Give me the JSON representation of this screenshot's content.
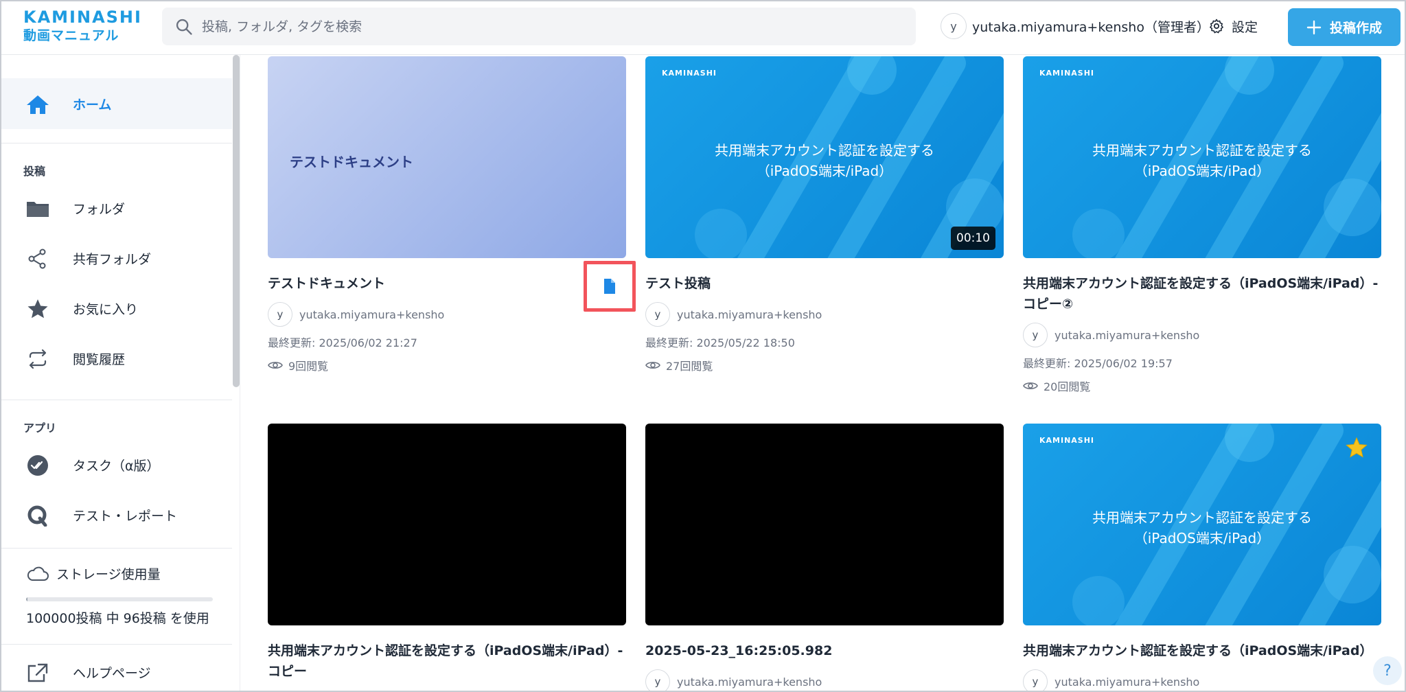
{
  "header": {
    "logo_main": "KAMINASHI",
    "logo_sub": "動画マニュアル",
    "search_placeholder": "投稿, フォルダ, タグを検索",
    "user_initial": "y",
    "user_name": "yutaka.miyamura+kensho（管理者）",
    "settings_label": "設定",
    "create_label": "投稿作成"
  },
  "sidebar": {
    "home": "ホーム",
    "section_posts": "投稿",
    "folder": "フォルダ",
    "shared_folder": "共有フォルダ",
    "favorites": "お気に入り",
    "history": "閲覧履歴",
    "section_apps": "アプリ",
    "task": "タスク（α版）",
    "test_report": "テスト・レポート",
    "storage_title": "ストレージ使用量",
    "storage_text": "100000投稿 中 96投稿 を使用",
    "storage_fraction": 0.00096,
    "help": "ヘルプページ"
  },
  "cards": [
    {
      "thumb_text": "テストドキュメント",
      "title": "テストドキュメント",
      "author_initial": "y",
      "author": "yutaka.miyamura+kensho",
      "updated": "最終更新: 2025/06/02 21:27",
      "views": "9回閲覧"
    },
    {
      "brand": "KAMINASHI",
      "caption_line1": "共用端末アカウント認証を設定する",
      "caption_line2": "（iPadOS端末/iPad）",
      "duration": "00:10",
      "title": "テスト投稿",
      "author_initial": "y",
      "author": "yutaka.miyamura+kensho",
      "updated": "最終更新: 2025/05/22 18:50",
      "views": "27回閲覧"
    },
    {
      "brand": "KAMINASHI",
      "caption_line1": "共用端末アカウント認証を設定する",
      "caption_line2": "（iPadOS端末/iPad）",
      "title_line1": "共用端末アカウント認証を設定する（iPadOS端末/iPad）-",
      "title_line2": "コピー②",
      "author_initial": "y",
      "author": "yutaka.miyamura+kensho",
      "updated": "最終更新: 2025/06/02 19:57",
      "views": "20回閲覧"
    },
    {
      "title_line1": "共用端末アカウント認証を設定する（iPadOS端末/iPad）-",
      "title_line2": "コピー"
    },
    {
      "title": "2025-05-23_16:25:05.982",
      "author_initial": "y",
      "author": "yutaka.miyamura+kensho"
    },
    {
      "brand": "KAMINASHI",
      "caption_line1": "共用端末アカウント認証を設定する",
      "caption_line2": "（iPadOS端末/iPad）",
      "title": "共用端末アカウント認証を設定する（iPadOS端末/iPad）",
      "author_initial": "y",
      "author": "yutaka.miyamura+kensho"
    }
  ],
  "help_button": "?",
  "colors": {
    "brand": "#1e9be0",
    "accent": "#35a6e6",
    "highlight": "#f2545b",
    "star": "#f4c21f"
  }
}
